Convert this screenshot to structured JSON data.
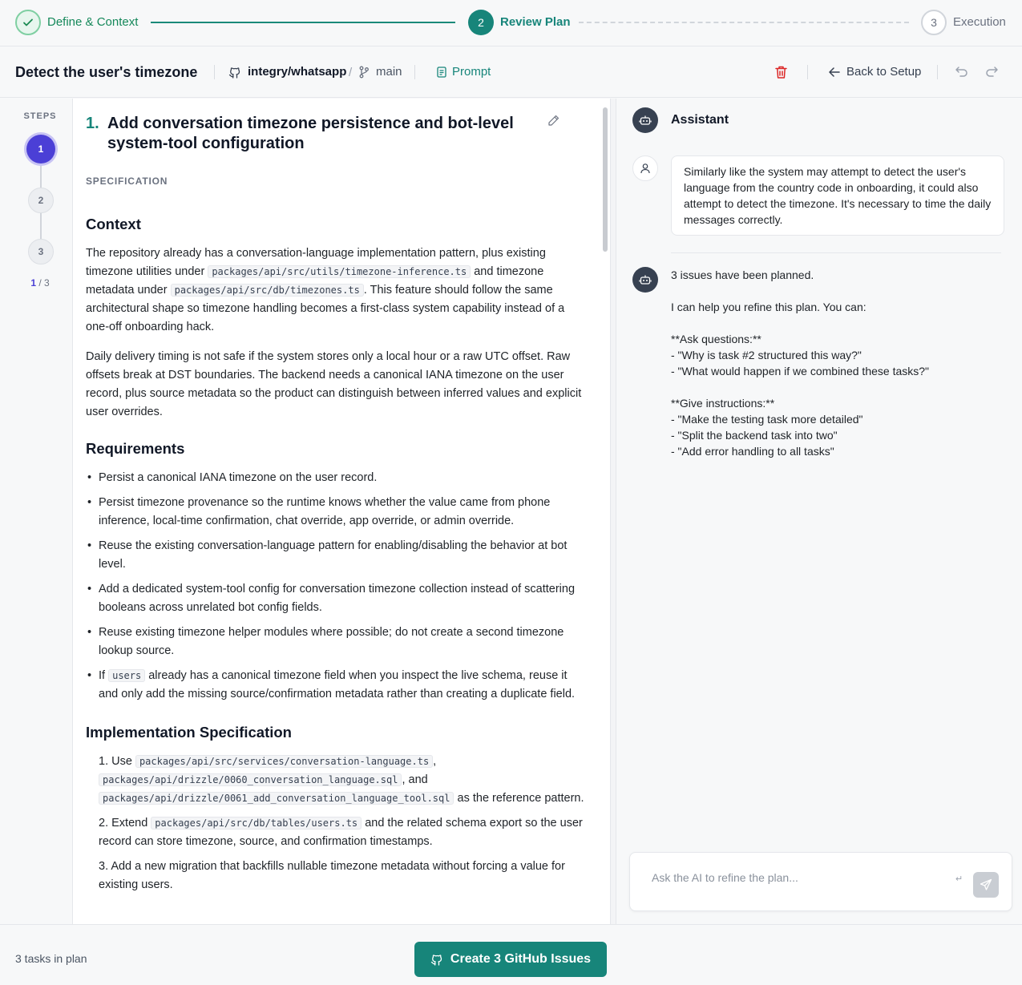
{
  "stepper": {
    "steps": [
      {
        "label": "Define & Context",
        "marker": "✓"
      },
      {
        "label": "Review Plan",
        "marker": "2"
      },
      {
        "label": "Execution",
        "marker": "3"
      }
    ]
  },
  "header": {
    "title": "Detect the user's timezone",
    "repo": "integry/whatsapp",
    "separator": "/",
    "branch": "main",
    "prompt_label": "Prompt",
    "back_label": "Back to Setup"
  },
  "steps_rail": {
    "title": "STEPS",
    "steps": [
      "1",
      "2",
      "3"
    ],
    "current": "1",
    "total_text": "/ 3"
  },
  "task": {
    "number": "1.",
    "title": "Add conversation timezone persistence and bot-level system-tool configuration",
    "spec_label": "SPECIFICATION",
    "context_heading": "Context",
    "context_p1_a": "The repository already has a conversation-language implementation pattern, plus existing timezone utilities under ",
    "context_p1_code1": "packages/api/src/utils/timezone-inference.ts",
    "context_p1_b": " and timezone metadata under ",
    "context_p1_code2": "packages/api/src/db/timezones.ts",
    "context_p1_c": ". This feature should follow the same architectural shape so timezone handling becomes a first-class system capability instead of a one-off onboarding hack.",
    "context_p2": "Daily delivery timing is not safe if the system stores only a local hour or a raw UTC offset. Raw offsets break at DST boundaries. The backend needs a canonical IANA timezone on the user record, plus source metadata so the product can distinguish between inferred values and explicit user overrides.",
    "requirements_heading": "Requirements",
    "req1": "Persist a canonical IANA timezone on the user record.",
    "req2": "Persist timezone provenance so the runtime knows whether the value came from phone inference, local-time confirmation, chat override, app override, or admin override.",
    "req3": "Reuse the existing conversation-language pattern for enabling/disabling the behavior at bot level.",
    "req4": "Add a dedicated system-tool config for conversation timezone collection instead of scattering booleans across unrelated bot config fields.",
    "req5": "Reuse existing timezone helper modules where possible; do not create a second timezone lookup source.",
    "req6_a": "If ",
    "req6_code": "users",
    "req6_b": " already has a canonical timezone field when you inspect the live schema, reuse it and only add the missing source/confirmation metadata rather than creating a duplicate field.",
    "impl_heading": "Implementation Specification",
    "impl1_a": "1. Use ",
    "impl1_code1": "packages/api/src/services/conversation-language.ts",
    "impl1_b": ", ",
    "impl1_code2": "packages/api/drizzle/0060_conversation_language.sql",
    "impl1_c": ", and ",
    "impl1_code3": "packages/api/drizzle/0061_add_conversation_language_tool.sql",
    "impl1_d": " as the reference pattern.",
    "impl2_a": "2. Extend ",
    "impl2_code": "packages/api/src/db/tables/users.ts",
    "impl2_b": " and the related schema export so the user record can store timezone, source, and confirmation timestamps.",
    "impl3": "3. Add a new migration that backfills nullable timezone metadata without forcing a value for existing users."
  },
  "chat": {
    "assistant_title": "Assistant",
    "user_message": "Similarly like the system may attempt to detect the user's language from the country code in onboarding, it could also attempt to detect the timezone. It's necessary to time the daily messages correctly.",
    "bot_message": "3 issues have been planned.\n\nI can help you refine this plan. You can:\n\n**Ask questions:**\n- \"Why is task #2 structured this way?\"\n- \"What would happen if we combined these tasks?\"\n\n**Give instructions:**\n- \"Make the testing task more detailed\"\n- \"Split the backend task into two\"\n- \"Add error handling to all tasks\"",
    "input_placeholder": "Ask the AI to refine the plan...",
    "input_value": "",
    "enter_hint": "↵"
  },
  "footer": {
    "tasks_text": "3 tasks in plan",
    "create_label": "Create 3 GitHub Issues"
  },
  "colors": {
    "accent": "#17857a",
    "active_step": "#4b3fd6",
    "danger": "#dc2626"
  },
  "icons": [
    "check-icon",
    "github-icon",
    "branch-icon",
    "document-icon",
    "trash-icon",
    "arrow-left-icon",
    "undo-icon",
    "redo-icon",
    "pencil-icon",
    "bot-icon",
    "user-icon",
    "send-icon"
  ]
}
